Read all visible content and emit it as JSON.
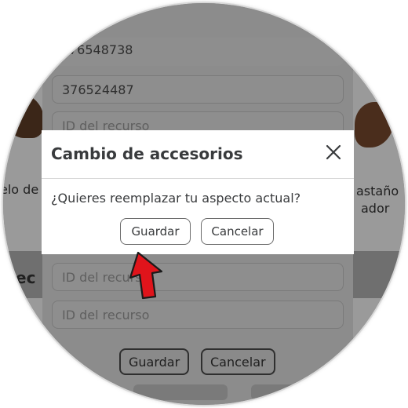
{
  "background_form": {
    "fields": [
      {
        "value": "76548738"
      },
      {
        "value": "376524487"
      },
      {
        "placeholder": "ID del recurso"
      },
      {
        "placeholder": "ID del recurso"
      },
      {
        "placeholder": "ID del recurso"
      }
    ],
    "save_label": "Guardar",
    "cancel_label": "Cancelar"
  },
  "side_items": {
    "left_text": "elo de",
    "left_heading_fragment": "ec",
    "right_text_line1": "astaño",
    "right_text_line2": "ador"
  },
  "modal": {
    "title": "Cambio de accesorios",
    "message": "¿Quieres reemplazar tu aspecto actual?",
    "save_label": "Guardar",
    "cancel_label": "Cancelar",
    "close_icon": "close-icon"
  },
  "annotation": {
    "arrow_icon": "arrow-up-icon",
    "arrow_color": "#e0141b"
  },
  "colors": {
    "overlay": "#8a8a8a",
    "modal_bg": "#ffffff",
    "text": "#393b3d"
  }
}
